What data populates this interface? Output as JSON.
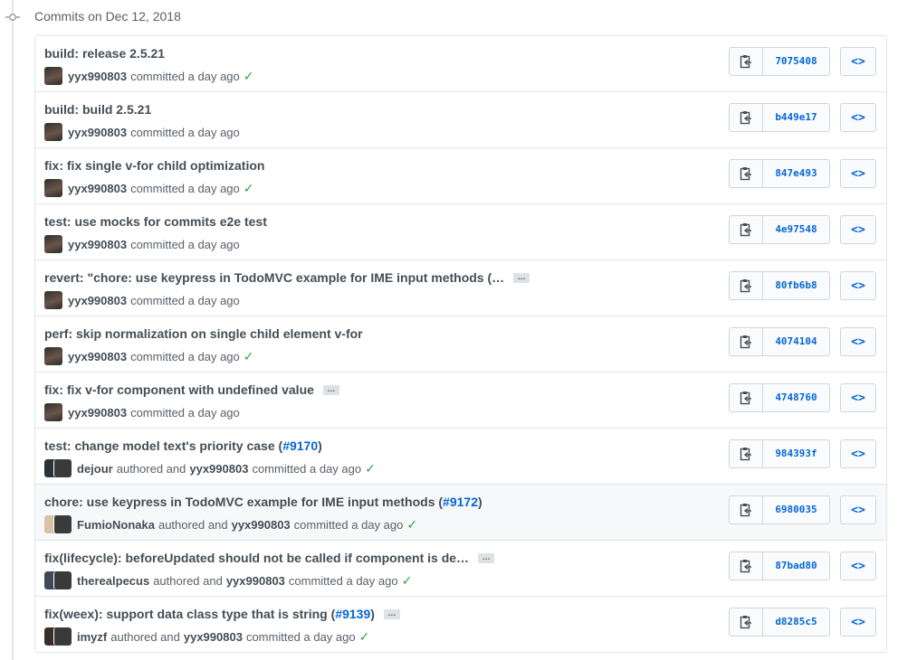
{
  "group": {
    "title": "Commits on Dec 12, 2018"
  },
  "commits": [
    {
      "title": "build: release 2.5.21",
      "pr": "",
      "pr_close": "",
      "ellipsis": false,
      "avatar": "single",
      "author": "yyx990803",
      "verb": "committed a day ago",
      "coauthor": "",
      "mid": "",
      "check": "✓",
      "sha": "7075408",
      "highlight": false
    },
    {
      "title": "build: build 2.5.21",
      "pr": "",
      "pr_close": "",
      "ellipsis": false,
      "avatar": "single",
      "author": "yyx990803",
      "verb": "committed a day ago",
      "coauthor": "",
      "mid": "",
      "check": "",
      "sha": "b449e17",
      "highlight": false
    },
    {
      "title": "fix: fix single v-for child optimization",
      "pr": "",
      "pr_close": "",
      "ellipsis": false,
      "avatar": "single",
      "author": "yyx990803",
      "verb": "committed a day ago",
      "coauthor": "",
      "mid": "",
      "check": "✓",
      "sha": "847e493",
      "highlight": false
    },
    {
      "title": "test: use mocks for commits e2e test",
      "pr": "",
      "pr_close": "",
      "ellipsis": false,
      "avatar": "single",
      "author": "yyx990803",
      "verb": "committed a day ago",
      "coauthor": "",
      "mid": "",
      "check": "",
      "sha": "4e97548",
      "highlight": false
    },
    {
      "title": "revert: \"chore: use keypress in TodoMVC example for IME input methods (…",
      "pr": "",
      "pr_close": "",
      "ellipsis": true,
      "avatar": "single",
      "author": "yyx990803",
      "verb": "committed a day ago",
      "coauthor": "",
      "mid": "",
      "check": "",
      "sha": "80fb6b8",
      "highlight": false
    },
    {
      "title": "perf: skip normalization on single child element v-for",
      "pr": "",
      "pr_close": "",
      "ellipsis": false,
      "avatar": "single",
      "author": "yyx990803",
      "verb": "committed a day ago",
      "coauthor": "",
      "mid": "",
      "check": "✓",
      "sha": "4074104",
      "highlight": false
    },
    {
      "title": "fix: fix v-for component with undefined value",
      "pr": "",
      "pr_close": "",
      "ellipsis": true,
      "avatar": "single",
      "author": "yyx990803",
      "verb": "committed a day ago",
      "coauthor": "",
      "mid": "",
      "check": "",
      "sha": "4748760",
      "highlight": false
    },
    {
      "title": "test: change model text's priority case (",
      "pr": "#9170",
      "pr_close": ")",
      "ellipsis": false,
      "avatar": "pair",
      "author": "dejour",
      "mid": "authored and",
      "coauthor": "yyx990803",
      "verb": "committed a day ago",
      "check": "✓",
      "sha": "984393f",
      "highlight": false
    },
    {
      "title": "chore: use keypress in TodoMVC example for IME input methods (",
      "pr": "#9172",
      "pr_close": ")",
      "ellipsis": false,
      "avatar": "pair",
      "author": "FumioNonaka",
      "mid": "authored and",
      "coauthor": "yyx990803",
      "verb": "committed a day ago",
      "check": "✓",
      "sha": "6980035",
      "highlight": true
    },
    {
      "title": "fix(lifecycle): beforeUpdated should not be called if component is de…",
      "pr": "",
      "pr_close": "",
      "ellipsis": true,
      "avatar": "pair",
      "author": "therealpecus",
      "mid": "authored and",
      "coauthor": "yyx990803",
      "verb": "committed a day ago",
      "check": "✓",
      "sha": "87bad80",
      "highlight": false
    },
    {
      "title": "fix(weex): support data class type that is string (",
      "pr": "#9139",
      "pr_close": ")",
      "ellipsis": true,
      "avatar": "pair",
      "author": "imyzf",
      "mid": "authored and",
      "coauthor": "yyx990803",
      "verb": "committed a day ago",
      "check": "✓",
      "sha": "d8285c5",
      "highlight": false
    }
  ],
  "icons": {
    "copy": "clipboard-icon",
    "browse": "code-icon",
    "commit": "git-commit-icon",
    "check": "check-icon"
  },
  "labels": {
    "ellipsis": "…",
    "browse": "<>"
  },
  "colors": {
    "link": "#0366d6",
    "check": "#28a745",
    "border": "#e1e4e8",
    "highlight": "#f6f8fa"
  }
}
